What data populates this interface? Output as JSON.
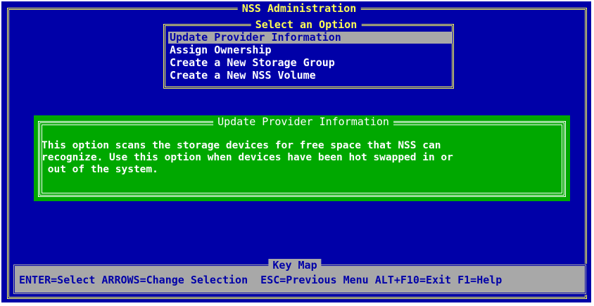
{
  "app": {
    "title": "NSS Administration"
  },
  "menu": {
    "title": "Select an Option",
    "items": [
      {
        "label": "Update Provider Information",
        "selected": true
      },
      {
        "label": "Assign Ownership",
        "selected": false
      },
      {
        "label": "Create a New Storage Group",
        "selected": false
      },
      {
        "label": "Create a New NSS Volume",
        "selected": false
      }
    ]
  },
  "info": {
    "title": "Update Provider Information",
    "lines": [
      "This option scans the storage devices for free space that NSS can",
      "recognize. Use this option when devices have been hot swapped in or",
      " out of the system."
    ]
  },
  "keymap": {
    "title": "Key Map",
    "text": "ENTER=Select ARROWS=Change Selection  ESC=Previous Menu ALT+F10=Exit F1=Help"
  },
  "colors": {
    "background": "#0000a8",
    "frame": "#ffff55",
    "selection": "#a8a8a8",
    "info_panel": "#00a800",
    "text": "#ffffff"
  }
}
